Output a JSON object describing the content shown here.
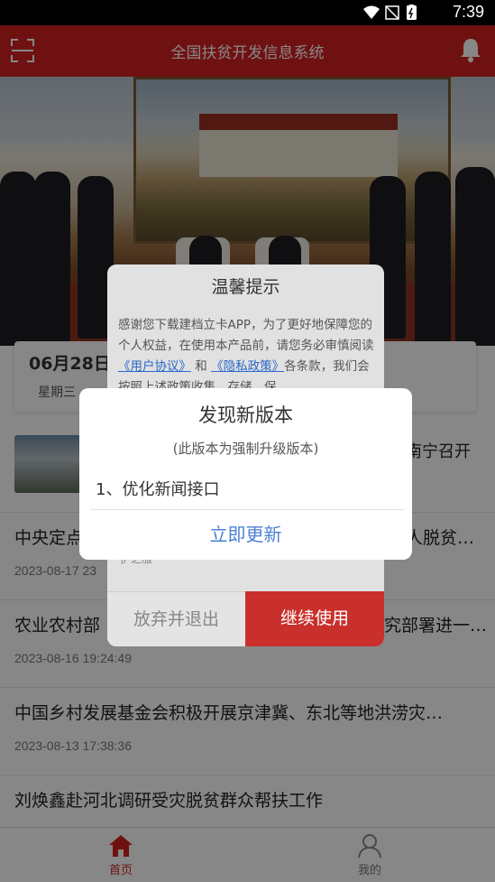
{
  "status_bar": {
    "time": "7:39",
    "icons": [
      "wifi-icon",
      "signal-icon",
      "battery-icon"
    ]
  },
  "header": {
    "title": "全国扶贫开发信息系统",
    "left_icon": "scan-icon",
    "right_icon": "bell-icon"
  },
  "date_card": {
    "date": "06月28日",
    "weekday": "星期三"
  },
  "news": {
    "featured": {
      "title": "南宁召开"
    },
    "items": [
      {
        "title": "中央定点",
        "trailing": "人脱贫…",
        "time": "2023-08-17 23"
      },
      {
        "title": "农业农村部",
        "trailing": "究部署进一…",
        "time": "2023-08-16 19:24:49"
      },
      {
        "title": "中国乡村发展基金会积极开展京津冀、东北等地洪涝灾…",
        "time": "2023-08-13 17:38:36"
      },
      {
        "title": "刘焕鑫赴河北调研受灾脱贫群众帮扶工作",
        "time": ""
      }
    ]
  },
  "tabs": [
    {
      "label": "首页",
      "icon": "home-icon",
      "active": true
    },
    {
      "label": "我的",
      "icon": "user-icon",
      "active": false
    }
  ],
  "privacy_dialog": {
    "title": "温馨提示",
    "body_pre": "感谢您下载建档立卡APP，为了更好地保障您的个人权益，在使用本产品前，请您务必审慎阅读",
    "link_user": "《用户协议》",
    "body_and": " 和 ",
    "link_privacy": "《隐私政策》",
    "body_post": "各条款，我们会按照上述政策收集、存储、保",
    "tail": "护之服",
    "quit_label": "放弃并退出",
    "continue_label": "继续使用"
  },
  "update_dialog": {
    "title": "发现新版本",
    "subtitle": "(此版本为强制升级版本)",
    "notes": "1、优化新闻接口",
    "button": "立即更新"
  },
  "colors": {
    "brand_red": "#d32020",
    "link_blue": "#2a67c9",
    "update_blue": "#4a80d6"
  }
}
